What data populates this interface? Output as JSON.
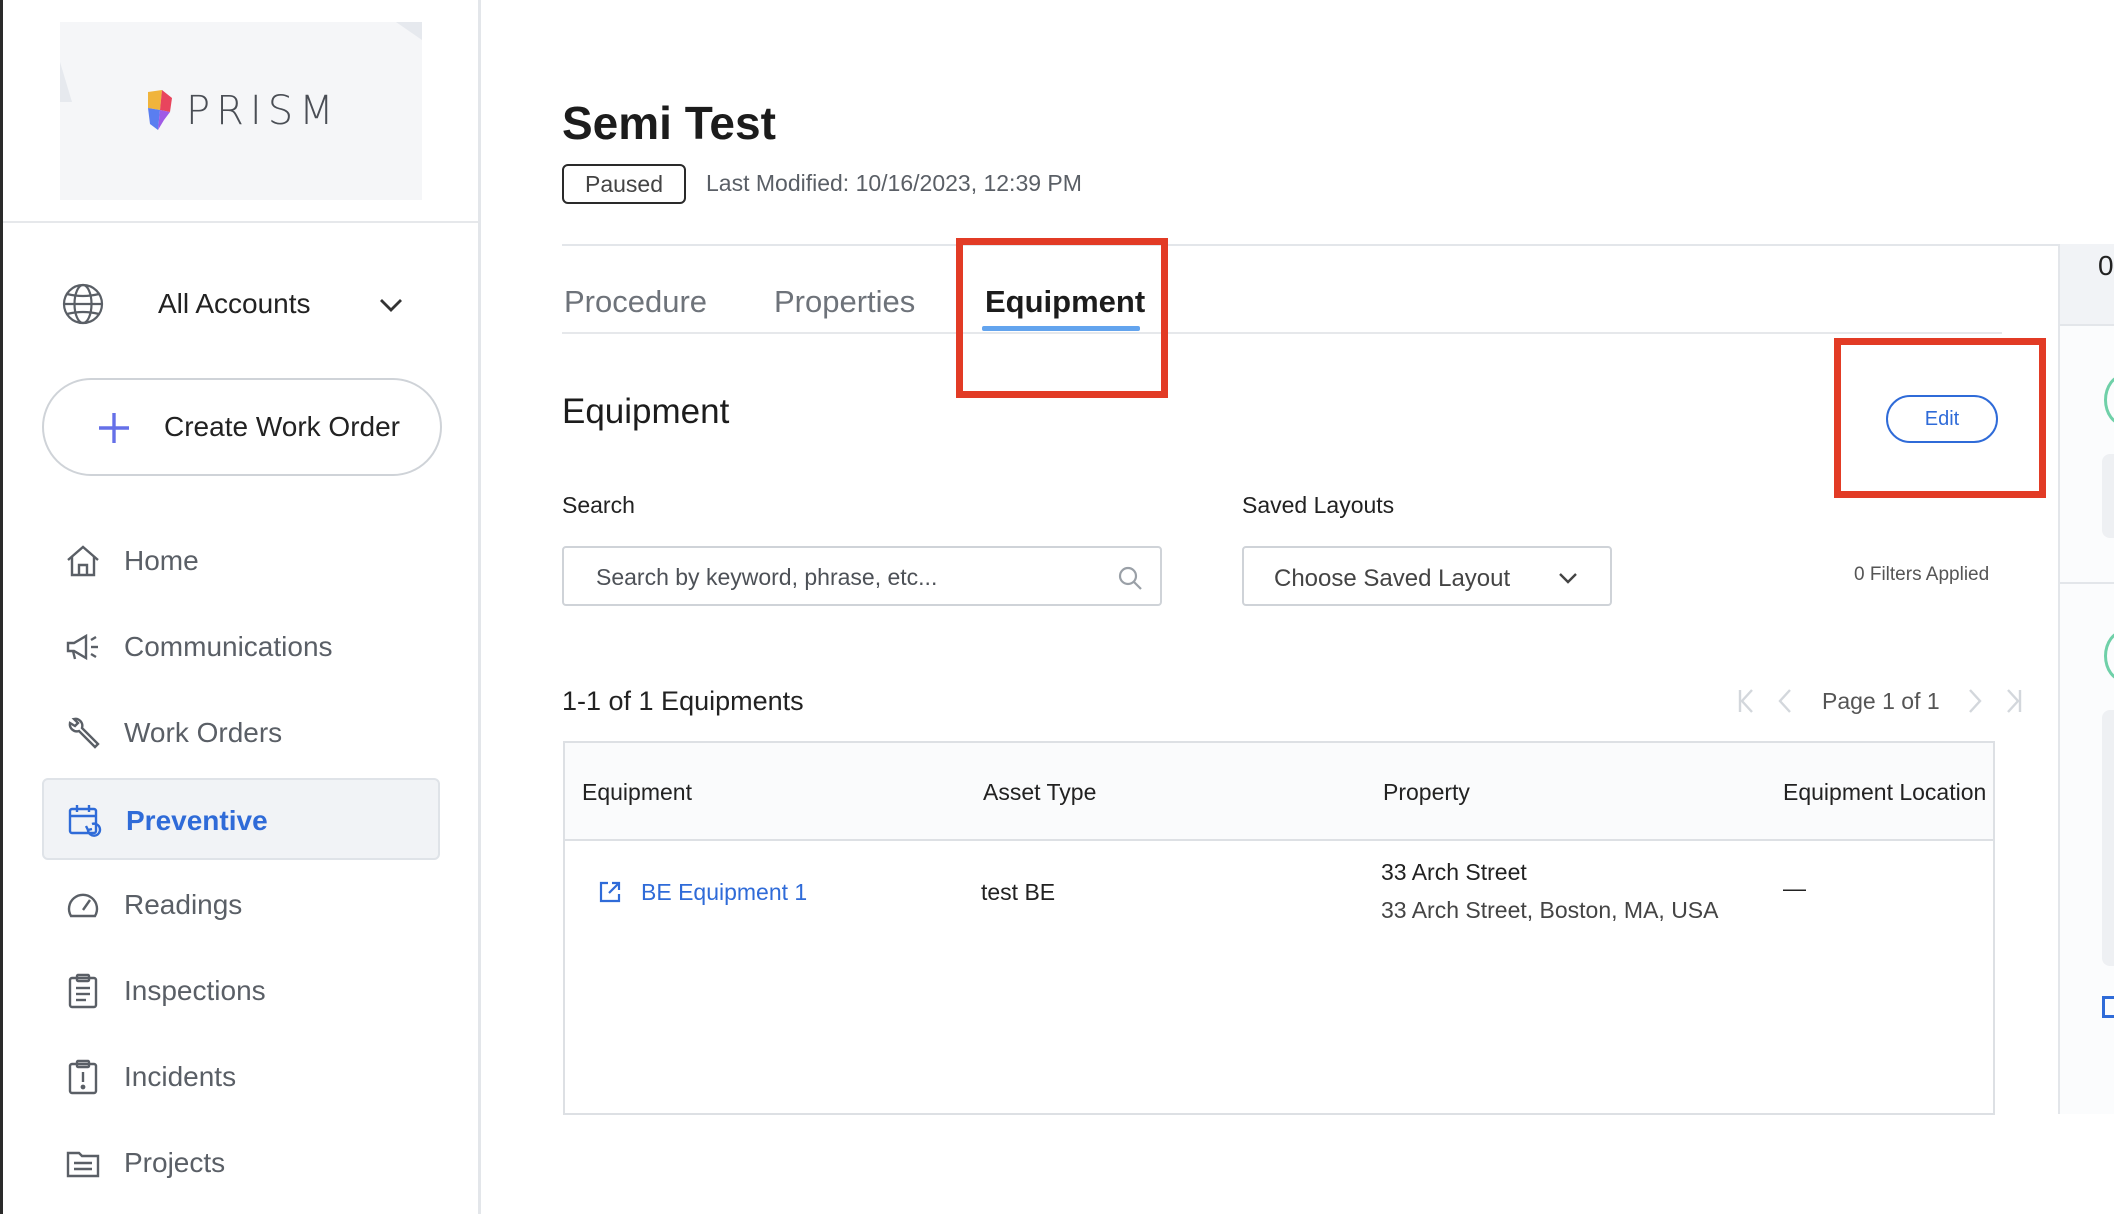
{
  "brand": {
    "name": "PRISM"
  },
  "sidebar": {
    "account_selector": {
      "label": "All Accounts"
    },
    "create_button": {
      "label": "Create Work Order"
    },
    "items": [
      {
        "label": "Home",
        "icon": "home-icon"
      },
      {
        "label": "Communications",
        "icon": "megaphone-icon"
      },
      {
        "label": "Work Orders",
        "icon": "wrench-icon"
      },
      {
        "label": "Preventive",
        "icon": "calendar-refresh-icon",
        "active": true
      },
      {
        "label": "Readings",
        "icon": "gauge-icon"
      },
      {
        "label": "Inspections",
        "icon": "clipboard-icon"
      },
      {
        "label": "Incidents",
        "icon": "alert-clipboard-icon"
      },
      {
        "label": "Projects",
        "icon": "folder-icon"
      }
    ]
  },
  "header": {
    "title": "Semi Test",
    "status": "Paused",
    "last_modified": "Last Modified: 10/16/2023, 12:39 PM"
  },
  "tabs": [
    {
      "label": "Procedure"
    },
    {
      "label": "Properties"
    },
    {
      "label": "Equipment",
      "active": true
    }
  ],
  "equipment_section": {
    "title": "Equipment",
    "edit_label": "Edit",
    "search": {
      "label": "Search",
      "placeholder": "Search by keyword, phrase, etc..."
    },
    "saved_layouts": {
      "label": "Saved Layouts",
      "value": "Choose Saved Layout"
    },
    "filters_applied": "0 Filters Applied",
    "count": "1-1 of 1 Equipments",
    "pagination": {
      "label": "Page 1 of 1"
    }
  },
  "table": {
    "columns": [
      "Equipment",
      "Asset Type",
      "Property",
      "Equipment Location"
    ],
    "rows": [
      {
        "equipment": "BE Equipment 1",
        "asset_type": "test BE",
        "property_name": "33 Arch Street",
        "property_address": "33 Arch Street, Boston, MA, USA",
        "location": "—"
      }
    ]
  },
  "right_panel": {
    "top_text": "0"
  },
  "colors": {
    "accent": "#2f6bd8",
    "tab_underline": "#63a4ee",
    "highlight": "#e23b25",
    "ring": "#6fd0a8"
  }
}
